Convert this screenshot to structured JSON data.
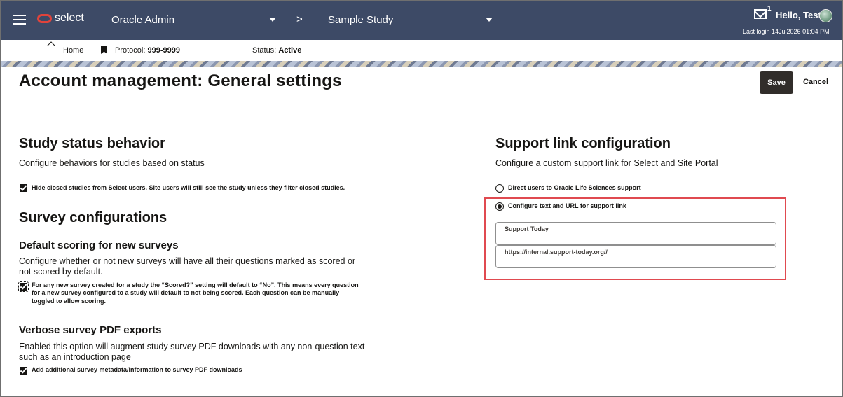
{
  "app": {
    "name": "select"
  },
  "nav": {
    "org": "Oracle Admin",
    "separator": ">",
    "study": "Sample Study",
    "mail_count": "1",
    "greeting": "Hello, Test",
    "last_login": "Last login 14Jul2026 01:04 PM"
  },
  "subnav": {
    "home": "Home",
    "protocol_label": "Protocol:",
    "protocol_value": "999-9999",
    "status_label": "Status:",
    "status_value": "Active"
  },
  "page": {
    "title": "Account management: General settings",
    "save_label": "Save",
    "cancel_label": "Cancel"
  },
  "study_status": {
    "heading": "Study status behavior",
    "description": "Configure behaviors for studies based on status",
    "checkbox_label": "Hide closed studies from Select users. Site users will still see the study unless they filter closed studies.",
    "checked": true
  },
  "survey": {
    "heading": "Survey configurations",
    "scoring_heading": "Default scoring for new surveys",
    "scoring_desc_1": "Configure whether or not new surveys will have all their questions marked as scored or",
    "scoring_desc_2": "not scored by default.",
    "scoring_cb_1": "For any new survey created for a study the “Scored?” setting will default to “No”. This means every question",
    "scoring_cb_2": "for a new survey configured to a study will default to not being scored. Each question can be manually",
    "scoring_cb_3": "toggled to allow scoring.",
    "scoring_checked": true,
    "pdf_heading": "Verbose survey PDF exports",
    "pdf_desc_1": "Enabled this option will augment study survey PDF downloads with any non-question text",
    "pdf_desc_2": "such as an introduction page",
    "pdf_cb": "Add additional survey metadata/information to survey PDF downloads",
    "pdf_checked": true
  },
  "support": {
    "heading": "Support link configuration",
    "description": "Configure a custom support link for Select and Site Portal",
    "option_1": "Direct users to Oracle Life Sciences support",
    "option_2": "Configure text and URL for support link",
    "selected": "option_2",
    "text_value": "Support Today",
    "url_value": "https://internal.support-today.org//"
  },
  "colors": {
    "header_bg": "#3d4a66",
    "primary_button": "#312d2a",
    "highlight_border": "#e04a50",
    "logo_red": "#e0433b"
  }
}
